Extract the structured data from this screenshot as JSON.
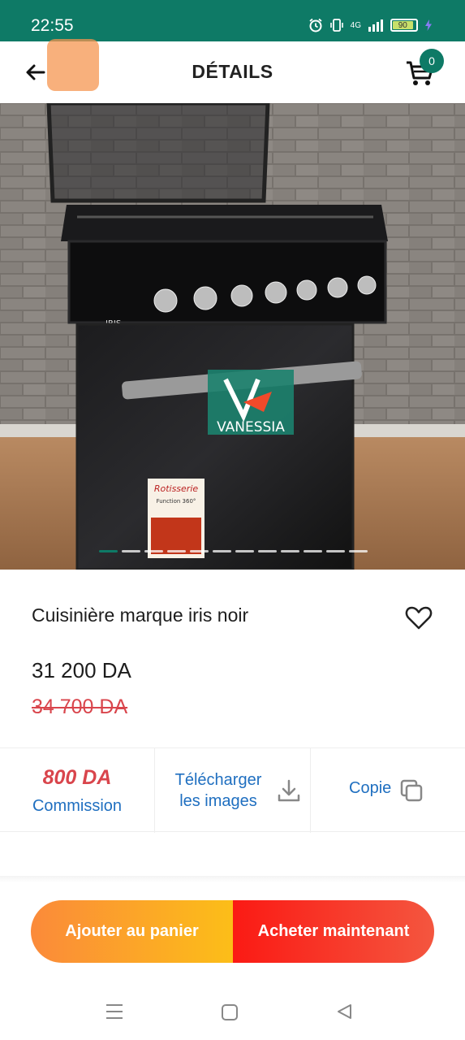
{
  "status_bar": {
    "time": "22:55",
    "network": "4G",
    "battery": "90"
  },
  "header": {
    "title": "DÉTAILS",
    "cart_count": "0"
  },
  "gallery": {
    "image_count": 12,
    "active_index": 0,
    "watermark": "VANESSIA",
    "brand_on_oven": "IRIS",
    "sticker_line1": "Rotisserie",
    "sticker_line2": "Function 360°"
  },
  "product": {
    "title": "Cuisinière marque iris noir",
    "price": "31 200 DA",
    "old_price": "34 700 DA"
  },
  "info": {
    "commission_amount": "800 DA",
    "commission_label": "Commission",
    "download_label_line1": "Télécharger",
    "download_label_line2": "les images",
    "copy_label": "Copie"
  },
  "actions": {
    "add_to_cart": "Ajouter au panier",
    "buy_now": "Acheter maintenant"
  },
  "colors": {
    "brand": "#0e7a66",
    "link_blue": "#1f6fc0",
    "price_red": "#d9454c",
    "orange": "#fb8a3a",
    "red": "#fb1a14"
  },
  "icons": [
    "back-arrow-icon",
    "cart-icon",
    "heart-icon",
    "download-icon",
    "copy-icon",
    "alarm-icon",
    "vibrate-icon",
    "signal-icon",
    "battery-icon",
    "menu-icon",
    "home-icon",
    "back-triangle-icon"
  ]
}
